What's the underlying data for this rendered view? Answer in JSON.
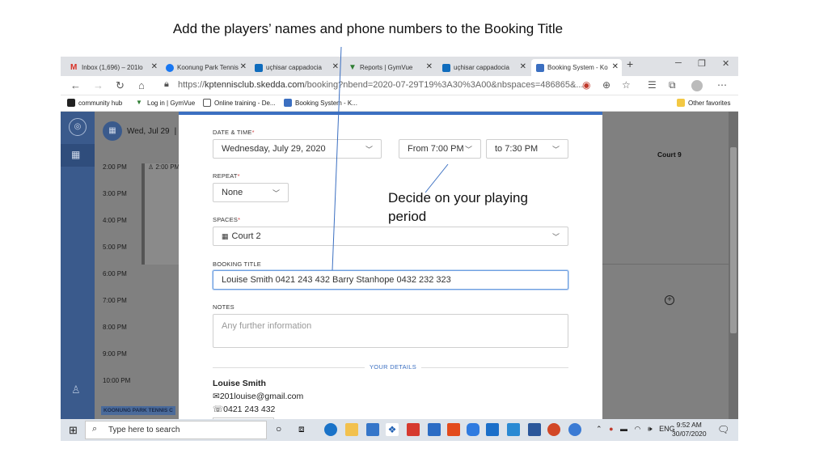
{
  "slide": {
    "title": "Add the players’ names and phone numbers to the Booking Title",
    "annotation": "Decide on your playing\nperiod"
  },
  "browser": {
    "tabs": [
      {
        "label": "Inbox (1,696) – 201lo",
        "icon": "gmail-icon",
        "color": "#d93025"
      },
      {
        "label": "Koonung Park Tennis",
        "icon": "facebook-icon",
        "color": "#1877f2"
      },
      {
        "label": "uçhisar cappadocia",
        "icon": "bing-icon",
        "color": "#0f6cbd"
      },
      {
        "label": "Reports | GymVue",
        "icon": "gymvue-icon",
        "color": "#2e7d32"
      },
      {
        "label": "uçhisar cappadocia",
        "icon": "bing-icon",
        "color": "#0f6cbd"
      },
      {
        "label": "Booking System - Ko",
        "icon": "skedda-icon",
        "color": "#3b6fc1"
      }
    ],
    "new_tab": "+",
    "url_prefix": "https://",
    "url_host": "kptennisclub.skedda.com",
    "url_path": "/booking?nbend=2020-07-29T19%3A30%3A00&nbspaces=486865&...",
    "favorites": [
      {
        "label": "community hub",
        "icon": "ipm-icon",
        "color": "#222"
      },
      {
        "label": "Log in | GymVue",
        "icon": "gymvue-icon",
        "color": "#2e7d32"
      },
      {
        "label": "Online training - De...",
        "icon": "page-icon",
        "color": "#fff"
      },
      {
        "label": "Booking System - K...",
        "icon": "skedda-icon",
        "color": "#3b6fc1"
      }
    ],
    "other_favorites": "Other favorites"
  },
  "schedule": {
    "date": "Wed, Jul 29",
    "hours": [
      "2:00 PM",
      "3:00 PM",
      "4:00 PM",
      "5:00 PM",
      "6:00 PM",
      "7:00 PM",
      "8:00 PM",
      "9:00 PM",
      "10:00 PM"
    ],
    "block_label": "2:00 PM",
    "venue": "KOONUNG PARK TENNIS C",
    "court": "Court 9"
  },
  "form": {
    "datetime_label": "DATE & TIME",
    "date_value": "Wednesday, July 29, 2020",
    "from_value": "From 7:00 PM",
    "to_value": "to 7:30 PM",
    "repeat_label": "REPEAT",
    "repeat_value": "None",
    "spaces_label": "SPACES",
    "spaces_value": "Court 2",
    "title_label": "BOOKING TITLE",
    "title_value": "Louise Smith 0421 243 432 Barry Stanhope 0432 232 323",
    "notes_label": "NOTES",
    "notes_placeholder": "Any further information",
    "your_details": "YOUR DETAILS",
    "user_name": "Louise Smith",
    "user_email": "201louise@gmail.com",
    "user_phone": "0421 243 432"
  },
  "taskbar": {
    "search_placeholder": "Type here to search",
    "lang": "ENG",
    "time": "9:52 AM",
    "date": "30/07/2020"
  },
  "colors": {
    "accent": "#3b6fc1",
    "rail": "#3a5a8c",
    "overlay": "#808080"
  }
}
